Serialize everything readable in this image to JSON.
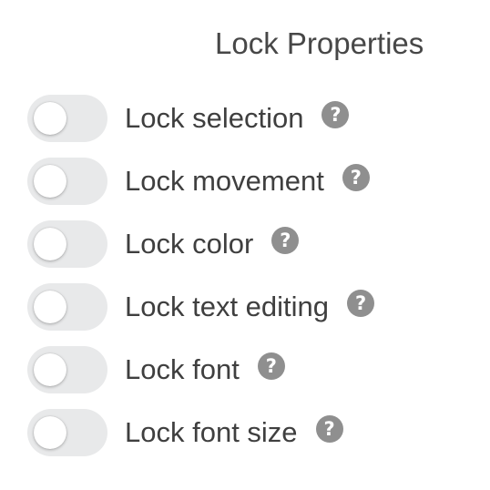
{
  "panel": {
    "title": "Lock Properties",
    "items": [
      {
        "label": "Lock selection",
        "enabled": false,
        "help_icon": "question-circle-icon",
        "help_glyph": "?"
      },
      {
        "label": "Lock movement",
        "enabled": false,
        "help_icon": "question-circle-icon",
        "help_glyph": "?"
      },
      {
        "label": "Lock color",
        "enabled": false,
        "help_icon": "question-circle-icon",
        "help_glyph": "?"
      },
      {
        "label": "Lock text editing",
        "enabled": false,
        "help_icon": "question-circle-icon",
        "help_glyph": "?"
      },
      {
        "label": "Lock font",
        "enabled": false,
        "help_icon": "question-circle-icon",
        "help_glyph": "?"
      },
      {
        "label": "Lock font size",
        "enabled": false,
        "help_icon": "question-circle-icon",
        "help_glyph": "?"
      }
    ]
  },
  "colors": {
    "toggle_track_off": "#e8e9ea",
    "toggle_knob": "#ffffff",
    "help_icon_bg": "#8f8f8f",
    "text": "#3f3f3f"
  }
}
